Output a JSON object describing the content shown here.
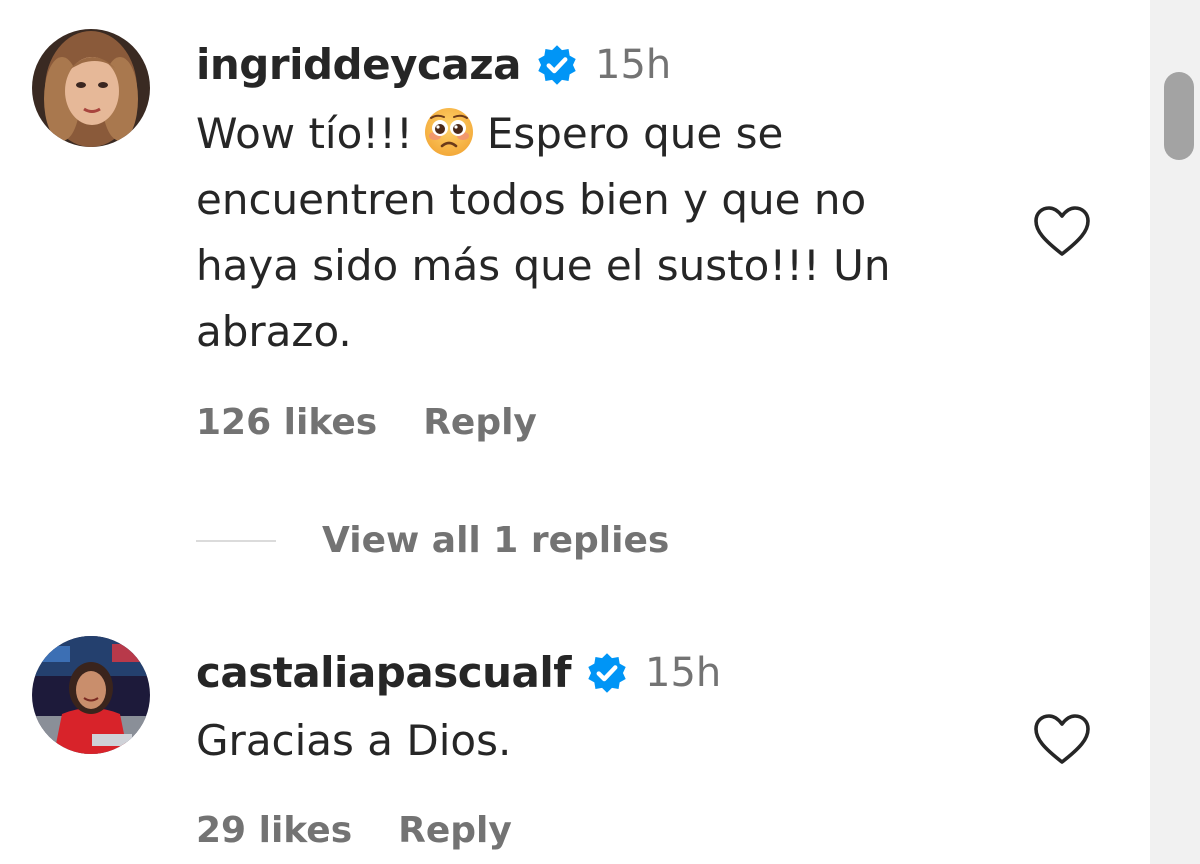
{
  "comments": [
    {
      "username": "ingriddeycaza",
      "verified": true,
      "time": "15h",
      "text_before_emoji": "Wow tío!!!",
      "emoji": "pleading-face",
      "text_after_emoji": "Espero que se encuentren todos bien y que no haya sido más que el susto!!! Un abrazo.",
      "likes": "126 likes",
      "reply_label": "Reply",
      "view_replies": "View all 1 replies"
    },
    {
      "username": "castaliapascualf",
      "verified": true,
      "time": "15h",
      "text": "Gracias a Dios.",
      "likes": "29 likes",
      "reply_label": "Reply"
    }
  ],
  "colors": {
    "primary_text": "#262626",
    "secondary_text": "#737373",
    "verified_blue": "#0095f6",
    "scrollbar_thumb": "#a3a3a3"
  }
}
